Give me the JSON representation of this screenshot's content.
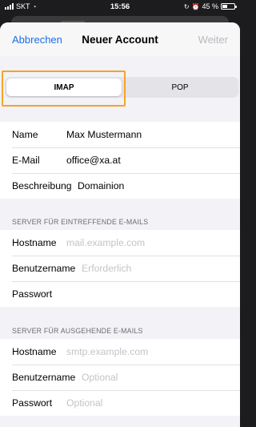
{
  "status_bar": {
    "carrier": "SKT",
    "time": "15:56",
    "battery": "45 %"
  },
  "nav": {
    "cancel": "Abbrechen",
    "title": "Neuer Account",
    "next": "Weiter"
  },
  "segment": {
    "options": [
      "IMAP",
      "POP"
    ],
    "selected": "IMAP"
  },
  "account": {
    "name_label": "Name",
    "name_value": "Max Mustermann",
    "email_label": "E-Mail",
    "email_value": "office@xa.at",
    "description_label": "Beschreibung",
    "description_value": "Domainion"
  },
  "incoming": {
    "header": "SERVER FÜR EINTREFFENDE E-MAILS",
    "hostname_label": "Hostname",
    "hostname_placeholder": "mail.example.com",
    "username_label": "Benutzername",
    "username_placeholder": "Erforderlich",
    "password_label": "Passwort",
    "password_placeholder": ""
  },
  "outgoing": {
    "header": "SERVER FÜR AUSGEHENDE E-MAILS",
    "hostname_label": "Hostname",
    "hostname_placeholder": "smtp.example.com",
    "username_label": "Benutzername",
    "username_placeholder": "Optional",
    "password_label": "Passwort",
    "password_placeholder": "Optional"
  },
  "colors": {
    "accent": "#1a6fe8",
    "highlight": "#f3a42c"
  }
}
